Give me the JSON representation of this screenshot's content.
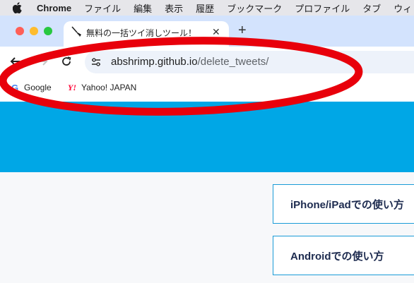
{
  "menubar": {
    "app_name": "Chrome",
    "items": [
      "ファイル",
      "編集",
      "表示",
      "履歴",
      "ブックマーク",
      "プロファイル",
      "タブ",
      "ウィ"
    ]
  },
  "tab": {
    "title": "無料の一括ツイ消しツール！",
    "close_label": "✕"
  },
  "new_tab_label": "+",
  "omnibox": {
    "url_host": "abshrimp.github.io",
    "url_path": "/delete_tweets/"
  },
  "bookmarks": [
    {
      "label": "Google",
      "icon": "google-g-icon"
    },
    {
      "label": "Yahoo! JAPAN",
      "icon": "yahoo-y-icon"
    }
  ],
  "guides": {
    "iphone": "iPhone/iPadでの使い方",
    "android": "Androidでの使い方"
  },
  "colors": {
    "hero": "#00a7e6",
    "annotation": "#e8000b",
    "button_border": "#1a9bd7",
    "tabstrip": "#d3e3fd"
  }
}
